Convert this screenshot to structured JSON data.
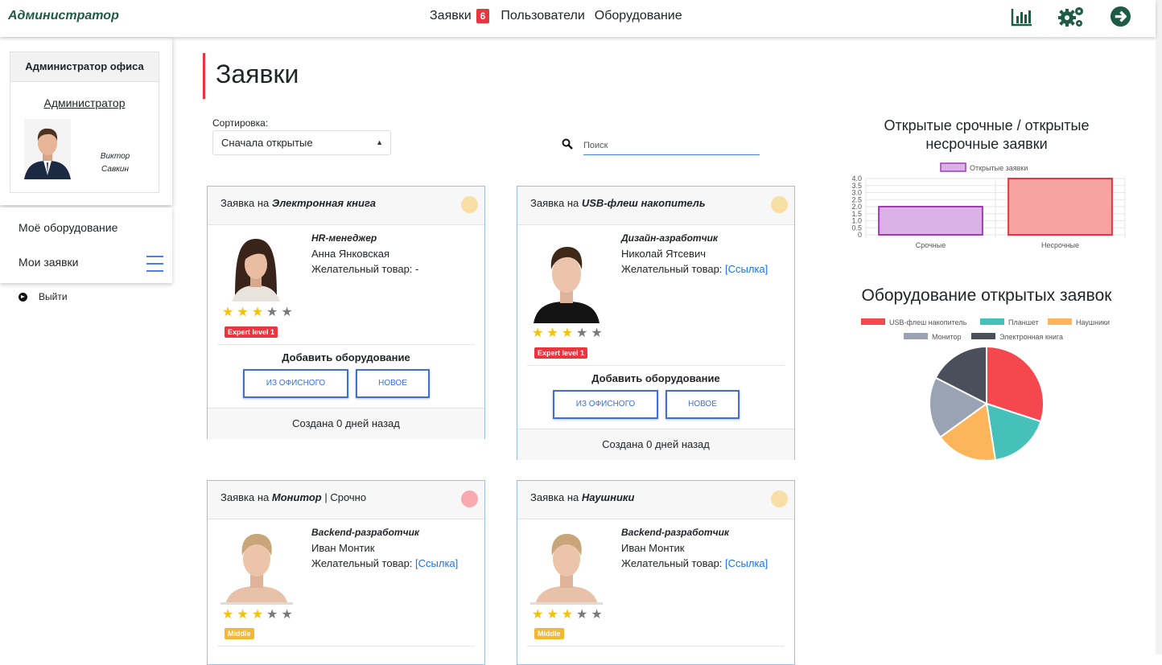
{
  "header": {
    "brand": "Администратор",
    "nav": [
      {
        "label": "Заявки",
        "badge": "6"
      },
      {
        "label": "Пользователи"
      },
      {
        "label": "Оборудование"
      }
    ],
    "icons": [
      "bar-chart-icon",
      "gears-icon",
      "arrow-right-circle-icon"
    ]
  },
  "sidebar": {
    "office_header": "Администратор офиса",
    "role": "Администратор",
    "user_first": "Виктор",
    "user_last": "Савкин",
    "menu": [
      "Моё оборудование",
      "Мои заявки"
    ],
    "logout": "Выйти"
  },
  "main": {
    "title": "Заявки",
    "sort_label": "Сортировка:",
    "sort_value": "Сначала открытые",
    "search_placeholder": "Поиск"
  },
  "cards": [
    {
      "prefix": "Заявка на ",
      "item": "Электронная книга",
      "suffix": "",
      "dot_color": "#f7dfa6",
      "job": "HR-менеджер",
      "name": "Анна Янковская",
      "want_label": "Желательный товар: ",
      "want_value": "-",
      "rating": 3,
      "level": "Expert level 1",
      "level_color": "#e8363f",
      "add_title": "Добавить оборудование",
      "btn_office": "ИЗ ОФИСНОГО",
      "btn_new": "НОВОЕ",
      "footer": "Создана 0 дней назад"
    },
    {
      "prefix": "Заявка на ",
      "item": "USB-флеш накопитель",
      "suffix": "",
      "dot_color": "#f7dfa6",
      "job": "Дизайн-азработчик",
      "name": "Николай Ятсевич",
      "want_label": "Желательный товар: ",
      "want_value": "[Ссылка]",
      "rating": 3,
      "level": "Expert level 1",
      "level_color": "#e8363f",
      "add_title": "Добавить оборудование",
      "btn_office": "ИЗ ОФИСНОГО",
      "btn_new": "НОВОЕ",
      "footer": "Создана 0 дней назад"
    },
    {
      "prefix": "Заявка на ",
      "item": "Монитор",
      "suffix": " | Срочно",
      "dot_color": "#f8aab0",
      "job": "Backend-разработчик",
      "name": "Иван Монтик",
      "want_label": "Желательный товар: ",
      "want_value": "[Ссылка]",
      "rating": 3,
      "level": "Middle",
      "level_color": "#f5b633"
    },
    {
      "prefix": "Заявка на ",
      "item": "Наушники",
      "suffix": "",
      "dot_color": "#f7dfa6",
      "job": "Backend-разработчик",
      "name": "Иван Монтик",
      "want_label": "Желательный товар: ",
      "want_value": "[Ссылка]",
      "rating": 3,
      "level": "Middle",
      "level_color": "#f5b633"
    }
  ],
  "chart_data": [
    {
      "type": "bar",
      "title": "Открытые срочные / открытые несрочные заявки",
      "categories": [
        "Срочные",
        "Несрочные"
      ],
      "series": [
        {
          "name": "Открытые заявки",
          "values": [
            2,
            4
          ]
        }
      ],
      "colors": [
        "#dcb2e6",
        "#f7a3a3"
      ],
      "border_colors": [
        "#a23ab8",
        "#e8363f"
      ],
      "ylim": [
        0,
        4
      ],
      "yticks": [
        "0",
        "0.5",
        "1.0",
        "1.5",
        "2.0",
        "2.5",
        "3.0",
        "3.5",
        "4.0"
      ],
      "grid": true,
      "legend": "top"
    },
    {
      "type": "pie",
      "title": "Оборудование открытых заявок",
      "categories": [
        "USB-флеш накопитель",
        "Планшет",
        "Наушники",
        "Монитор",
        "Электронная книга"
      ],
      "values": [
        1.1,
        0.64,
        0.64,
        0.64,
        0.64
      ],
      "colors": [
        "#f5474e",
        "#45c1b9",
        "#fdb55c",
        "#9aa3b3",
        "#4b4f5c"
      ],
      "legend": "top"
    }
  ]
}
